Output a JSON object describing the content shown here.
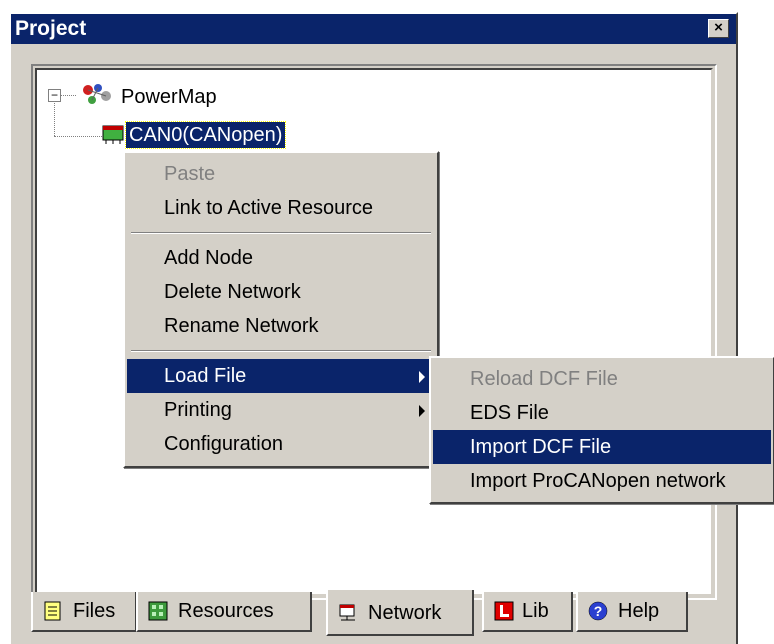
{
  "window": {
    "title": "Project",
    "close_glyph": "×"
  },
  "tree": {
    "expander_glyph": "−",
    "root": {
      "label": "PowerMap",
      "icon": "powermap-icon"
    },
    "child": {
      "label": "CAN0(CANopen)",
      "icon": "can-network-icon",
      "selected": true
    }
  },
  "context_menu": {
    "items": [
      {
        "label": "Paste",
        "disabled": true
      },
      {
        "label": "Link to Active Resource"
      },
      {
        "label": "Add Node"
      },
      {
        "label": "Delete Network"
      },
      {
        "label": "Rename Network"
      },
      {
        "label": "Load File",
        "highlighted": true,
        "submenu": true
      },
      {
        "label": "Printing",
        "submenu": true
      },
      {
        "label": "Configuration"
      }
    ]
  },
  "submenu": {
    "items": [
      {
        "label": "Reload DCF File",
        "disabled": true
      },
      {
        "label": "EDS File"
      },
      {
        "label": "Import DCF File",
        "highlighted": true
      },
      {
        "label": "Import ProCANopen network"
      }
    ]
  },
  "tabs": [
    {
      "label": "Files",
      "icon": "files-icon"
    },
    {
      "label": "Resources",
      "icon": "resources-icon"
    },
    {
      "label": "Network",
      "icon": "network-icon",
      "active": true
    },
    {
      "label": "Lib",
      "icon": "lib-icon"
    },
    {
      "label": "Help",
      "icon": "help-icon"
    }
  ],
  "colors": {
    "highlight": "#0a246a",
    "face": "#d4d0c8",
    "disabled_text": "#808080"
  }
}
